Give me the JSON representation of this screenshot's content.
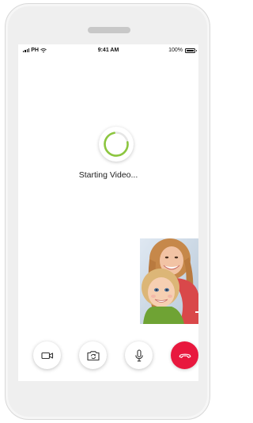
{
  "status_bar": {
    "carrier": "PH",
    "time": "9:41 AM",
    "battery_percent": "100%"
  },
  "call": {
    "status_text": "Starting Video...",
    "spinner_progress": 0.75,
    "spinner_color": "#8cc63f"
  },
  "controls": {
    "video_icon": "video-camera-icon",
    "camera_switch_icon": "camera-switch-icon",
    "mic_icon": "microphone-icon",
    "hangup_icon": "phone-hangup-icon",
    "hangup_color": "#e8183e"
  },
  "pip": {
    "description_icon": "self-view-video"
  }
}
